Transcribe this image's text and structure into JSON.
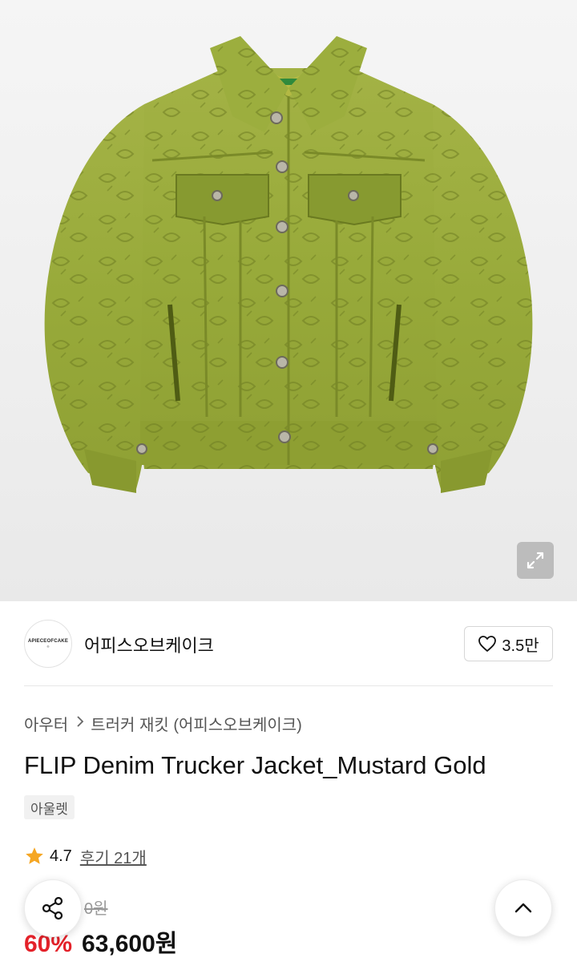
{
  "gallery": {
    "image_alt": "FLIP Denim Trucker Jacket_Mustard Gold",
    "label_brand_text": "APIECEOFCAKE",
    "expand_icon": "expand-icon"
  },
  "brand": {
    "logo_text": "APIECEOFCAKE",
    "logo_sub": "®",
    "name": "어피스오브케이크",
    "like_icon": "heart-outline-icon",
    "like_count": "3.5만"
  },
  "breadcrumb": {
    "category": "아우터",
    "separator_icon": "chevron-right-icon",
    "subcategory": "트러커 재킷 (어피스오브케이크)"
  },
  "product": {
    "title": "FLIP Denim Trucker Jacket_Mustard Gold",
    "tag": "아울렛",
    "rating": "4.7",
    "star_icon": "star-icon",
    "review_label": "후기 21개",
    "original_price": "0원",
    "discount": "60%",
    "sale_price": "63,600원"
  },
  "colors": {
    "discount_red": "#e4222a",
    "star_orange": "#f5a623",
    "jacket_green": "#9cad3c"
  },
  "floating": {
    "share_icon": "share-icon",
    "scroll_top_icon": "chevron-up-icon"
  }
}
